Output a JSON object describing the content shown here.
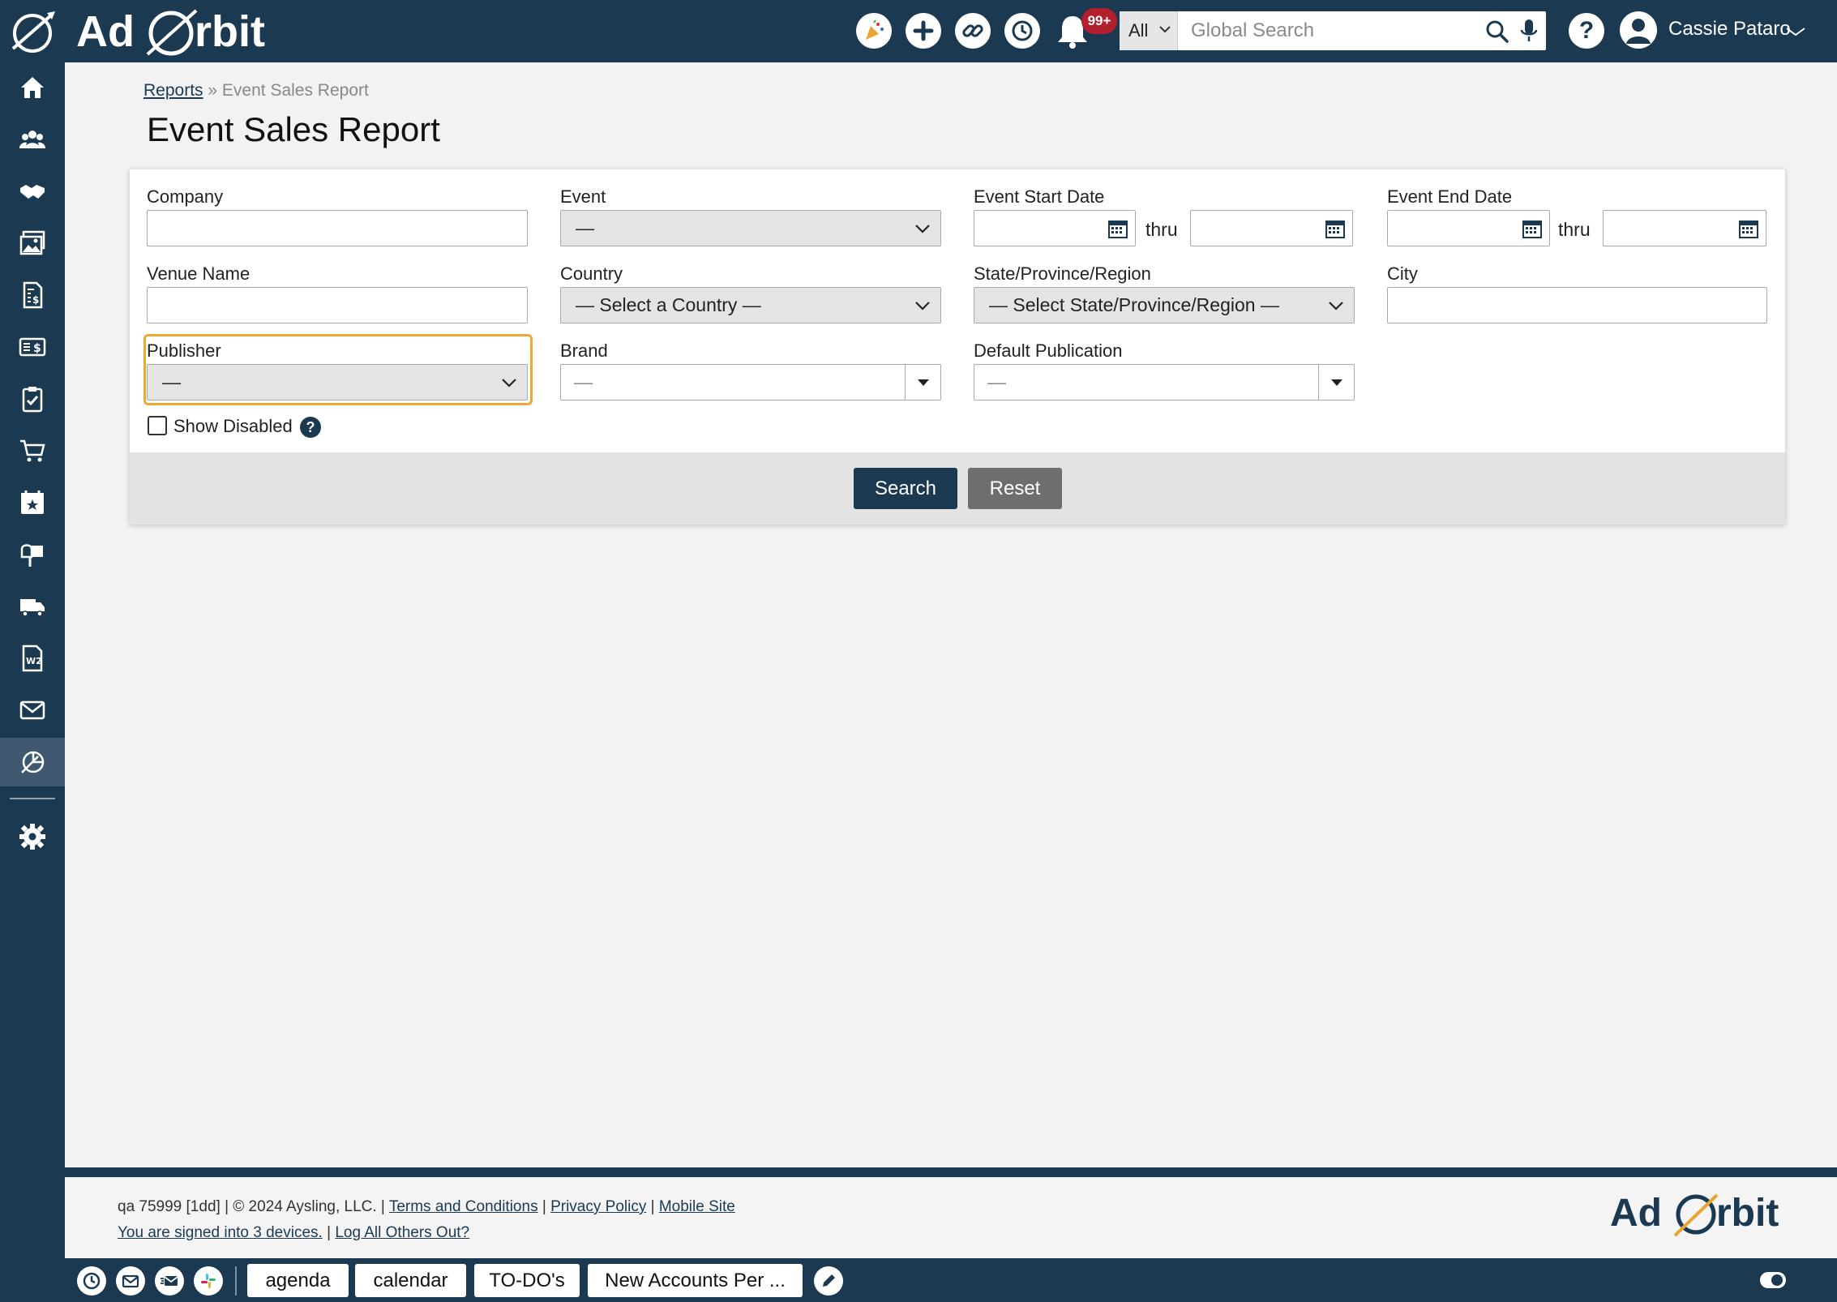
{
  "app": {
    "brand": "Ad Orbit",
    "notifications_badge": "99+",
    "search": {
      "scope": "All",
      "placeholder": "Global Search"
    },
    "user_name": "Cassie Pataro"
  },
  "breadcrumb": {
    "parent": "Reports",
    "separator": "»",
    "current": "Event Sales Report"
  },
  "page_title": "Event Sales Report",
  "form": {
    "company": {
      "label": "Company",
      "value": ""
    },
    "event": {
      "label": "Event",
      "value": "—"
    },
    "event_start_date": {
      "label": "Event Start Date",
      "thru": "thru"
    },
    "event_end_date": {
      "label": "Event End Date",
      "thru": "thru"
    },
    "venue_name": {
      "label": "Venue Name",
      "value": ""
    },
    "country": {
      "label": "Country",
      "value": "— Select a Country —"
    },
    "state": {
      "label": "State/Province/Region",
      "value": "— Select State/Province/Region —"
    },
    "city": {
      "label": "City",
      "value": ""
    },
    "publisher": {
      "label": "Publisher",
      "value": "—"
    },
    "brand": {
      "label": "Brand",
      "value": "—"
    },
    "default_publication": {
      "label": "Default Publication",
      "value": "—"
    },
    "show_disabled": {
      "label": "Show Disabled",
      "checked": false
    },
    "help_glyph": "?"
  },
  "buttons": {
    "search": "Search",
    "reset": "Reset"
  },
  "footer": {
    "build": "qa 75999 [1dd] | © 2024 Aysling, LLC. |",
    "links": {
      "terms": "Terms and Conditions",
      "privacy": "Privacy Policy",
      "mobile": "Mobile Site"
    },
    "pipe": "|",
    "signed_in": "You are signed into 3 devices.",
    "log_out": "Log All Others Out?"
  },
  "taskbar": {
    "tabs": [
      "agenda",
      "calendar",
      "TO-DO's",
      "New Accounts Per ..."
    ]
  },
  "colors": {
    "navy": "#1b3a52",
    "focus": "#f0a830",
    "badge": "#b21f2d",
    "reset": "#6e6e6e"
  }
}
